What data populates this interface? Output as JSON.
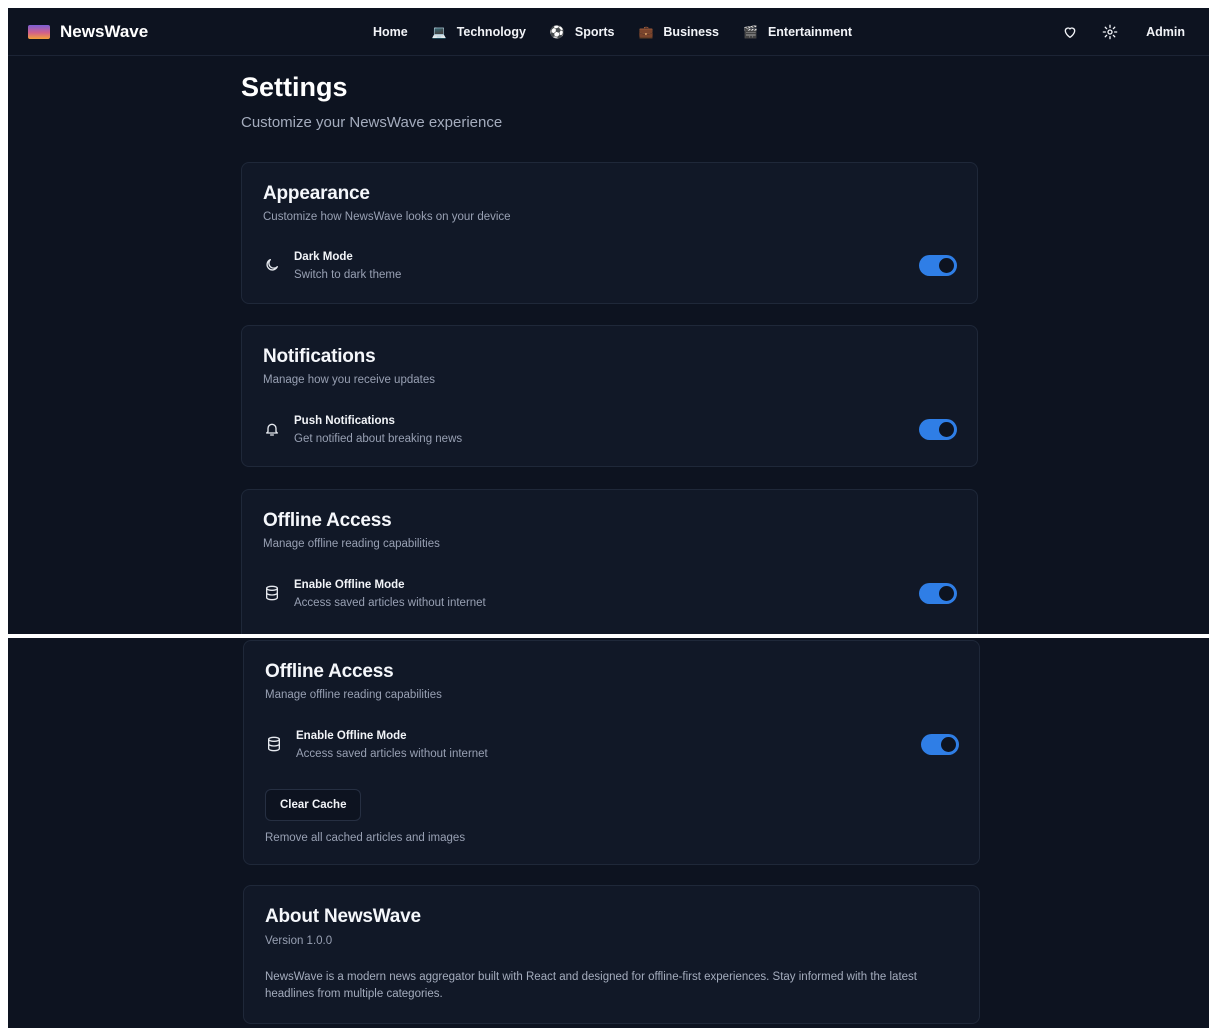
{
  "brand": {
    "name": "NewsWave"
  },
  "nav": {
    "links": [
      {
        "label": "Home",
        "icon": ""
      },
      {
        "label": "Technology",
        "icon": "laptop-emoji"
      },
      {
        "label": "Sports",
        "icon": "soccer-ball-emoji"
      },
      {
        "label": "Business",
        "icon": "briefcase-emoji"
      },
      {
        "label": "Entertainment",
        "icon": "clapperboard-emoji"
      }
    ],
    "right": {
      "user": "Admin",
      "icons": [
        "heart-icon",
        "gear-icon"
      ]
    }
  },
  "page": {
    "title": "Settings",
    "subtitle": "Customize your NewsWave experience"
  },
  "appearance": {
    "title": "Appearance",
    "desc": "Customize how NewsWave looks on your device",
    "setting": {
      "label": "Dark Mode",
      "sub": "Switch to dark theme",
      "enabled": true
    }
  },
  "notifications": {
    "title": "Notifications",
    "desc": "Manage how you receive updates",
    "setting": {
      "label": "Push Notifications",
      "sub": "Get notified about breaking news",
      "enabled": true
    }
  },
  "offline": {
    "title": "Offline Access",
    "desc": "Manage offline reading capabilities",
    "setting": {
      "label": "Enable Offline Mode",
      "sub": "Access saved articles without internet",
      "enabled": true
    },
    "clear_button": "Clear Cache",
    "clear_hint": "Remove all cached articles and images"
  },
  "about": {
    "title": "About NewsWave",
    "version": "Version 1.0.0",
    "text": "NewsWave is a modern news aggregator built with React and designed for offline-first experiences. Stay informed with the latest headlines from multiple categories."
  },
  "colors": {
    "background": "#0d1320",
    "card": "#111827",
    "accent": "#2f7ee6"
  }
}
